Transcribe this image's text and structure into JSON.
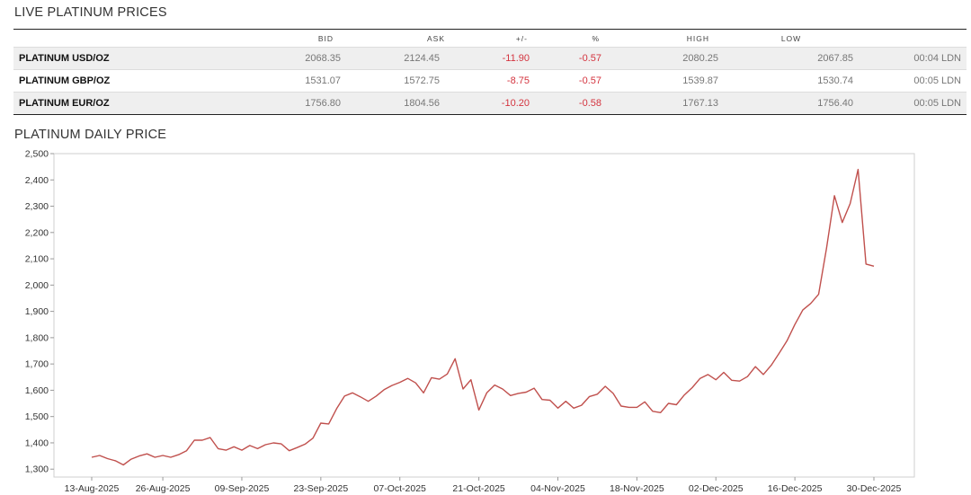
{
  "prices": {
    "title": "LIVE PLATINUM PRICES",
    "columns": [
      "",
      "BID",
      "ASK",
      "+/-",
      "%",
      "HIGH",
      "LOW",
      ""
    ],
    "rows": [
      {
        "label": "PLATINUM USD/OZ",
        "bid": "2068.35",
        "ask": "2124.45",
        "change": "-11.90",
        "pct": "-0.57",
        "high": "2080.25",
        "low": "2067.85",
        "time": "00:04 LDN"
      },
      {
        "label": "PLATINUM GBP/OZ",
        "bid": "1531.07",
        "ask": "1572.75",
        "change": "-8.75",
        "pct": "-0.57",
        "high": "1539.87",
        "low": "1530.74",
        "time": "00:05 LDN"
      },
      {
        "label": "PLATINUM EUR/OZ",
        "bid": "1756.80",
        "ask": "1804.56",
        "change": "-10.20",
        "pct": "-0.58",
        "high": "1767.13",
        "low": "1756.40",
        "time": "00:05 LDN"
      }
    ],
    "negative_color": "#d4343f"
  },
  "chart_data": {
    "type": "line",
    "title": "PLATINUM DAILY PRICE",
    "xlabel": "",
    "ylabel": "",
    "ylim": [
      1270,
      2500
    ],
    "yticks": [
      1300,
      1400,
      1500,
      1600,
      1700,
      1800,
      1900,
      2000,
      2100,
      2200,
      2300,
      2400,
      2500
    ],
    "ytick_labels": [
      "1,300",
      "1,400",
      "1,500",
      "1,600",
      "1,700",
      "1,800",
      "1,900",
      "2,000",
      "2,100",
      "2,200",
      "2,300",
      "2,400",
      "2,500"
    ],
    "xticks": [
      "13-Aug-2025",
      "26-Aug-2025",
      "09-Sep-2025",
      "23-Sep-2025",
      "07-Oct-2025",
      "21-Oct-2025",
      "04-Nov-2025",
      "18-Nov-2025",
      "02-Dec-2025",
      "16-Dec-2025",
      "30-Dec-2025"
    ],
    "xtick_index": [
      0,
      9,
      19,
      29,
      39,
      49,
      59,
      69,
      79,
      89,
      99
    ],
    "grid": false,
    "line_color": "#c0504d",
    "series": [
      {
        "values": [
          1345,
          1352,
          1340,
          1332,
          1316,
          1338,
          1350,
          1358,
          1345,
          1352,
          1345,
          1355,
          1370,
          1410,
          1410,
          1420,
          1378,
          1372,
          1385,
          1372,
          1390,
          1378,
          1393,
          1400,
          1396,
          1370,
          1382,
          1395,
          1418,
          1475,
          1472,
          1530,
          1578,
          1590,
          1575,
          1558,
          1578,
          1602,
          1618,
          1630,
          1645,
          1628,
          1590,
          1648,
          1642,
          1662,
          1720,
          1605,
          1640,
          1525,
          1590,
          1620,
          1605,
          1580,
          1588,
          1593,
          1608,
          1565,
          1562,
          1532,
          1558,
          1532,
          1543,
          1576,
          1585,
          1615,
          1588,
          1540,
          1535,
          1535,
          1556,
          1520,
          1515,
          1550,
          1545,
          1582,
          1610,
          1645,
          1660,
          1640,
          1668,
          1638,
          1635,
          1652,
          1690,
          1660,
          1695,
          1740,
          1788,
          1850,
          1905,
          1930,
          1965,
          2140,
          2340,
          2238,
          2310,
          2440,
          2080,
          2072
        ]
      }
    ]
  }
}
